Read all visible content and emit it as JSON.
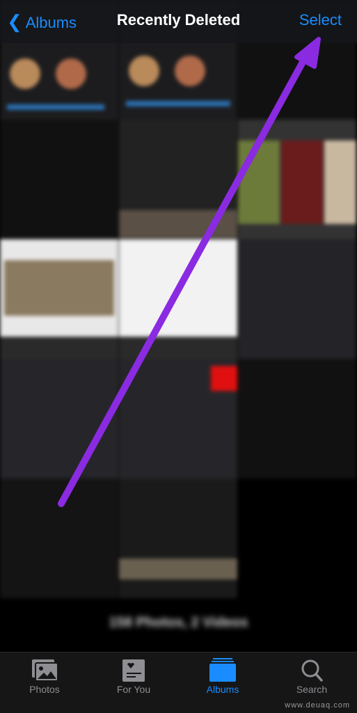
{
  "nav": {
    "back_label": "Albums",
    "title": "Recently Deleted",
    "select_label": "Select"
  },
  "footer": {
    "count": "158 Photos, 2 Videos"
  },
  "tabs": [
    {
      "label": "Photos",
      "icon": "photos-icon",
      "active": false
    },
    {
      "label": "For You",
      "icon": "for-you-icon",
      "active": false
    },
    {
      "label": "Albums",
      "icon": "albums-icon",
      "active": true
    },
    {
      "label": "Search",
      "icon": "search-icon",
      "active": false
    }
  ],
  "watermark": "www.deuaq.com",
  "colors": {
    "accent": "#1a8cff",
    "arrow": "#8a2be2",
    "tabbar": "#161616"
  }
}
